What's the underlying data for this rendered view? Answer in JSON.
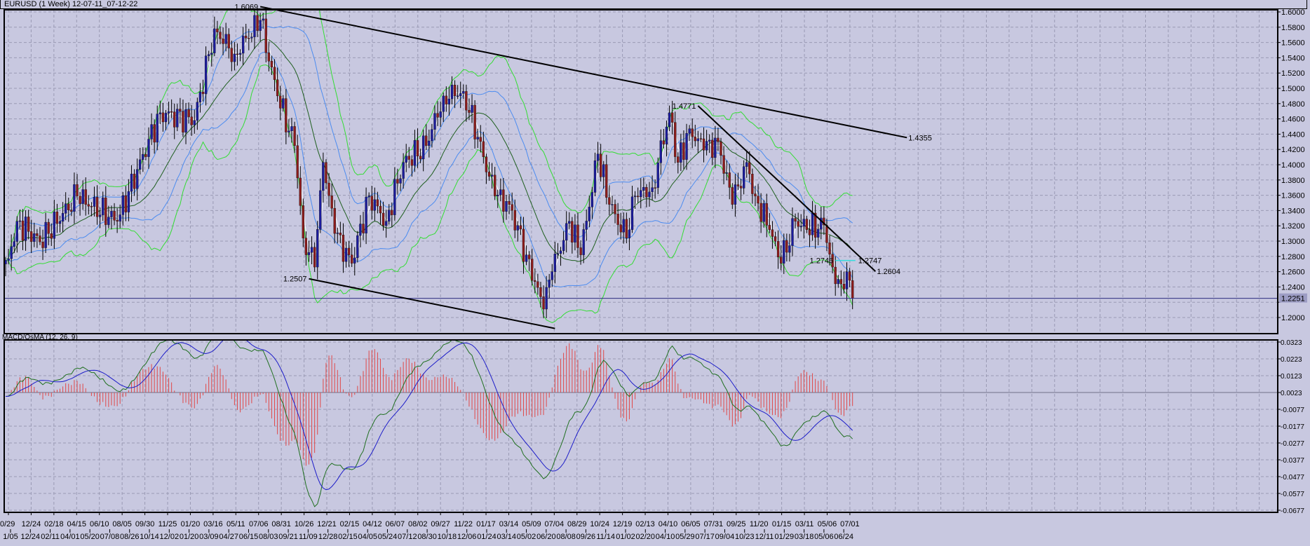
{
  "window": {
    "title": "EURUSD (1 Week) 12-07-11_07-12-22"
  },
  "indicator": {
    "label": "MACD/OsMA (12, 26, 9)"
  },
  "colors": {
    "background": "#c8c8e0",
    "bull": "#1c1c9c",
    "bear": "#8c1c1c",
    "bb_outer": "#33dd33",
    "bb_inner": "#4c8cf0",
    "ma": "#1f5f1f",
    "fast": "#ffffff",
    "macd_main": "#1f6f1f",
    "macd_signal": "#1c1cc8",
    "osma": "#e04848",
    "price_line": "#2c2c80",
    "cyan": "#33dddd"
  },
  "chart_data": [
    {
      "type": "candlestick",
      "title": "EURUSD (1 Week)",
      "bars": 297,
      "close_keypoints": [
        [
          0,
          1.275
        ],
        [
          1,
          1.277
        ],
        [
          4,
          1.326
        ],
        [
          12,
          1.299
        ],
        [
          25,
          1.359
        ],
        [
          39,
          1.326
        ],
        [
          54,
          1.468
        ],
        [
          66,
          1.458
        ],
        [
          73,
          1.578
        ],
        [
          80,
          1.545
        ],
        [
          89,
          1.589
        ],
        [
          95,
          1.49
        ],
        [
          101,
          1.425
        ],
        [
          104,
          1.304
        ],
        [
          108,
          1.266
        ],
        [
          111,
          1.403
        ],
        [
          115,
          1.31
        ],
        [
          121,
          1.271
        ],
        [
          127,
          1.359
        ],
        [
          133,
          1.326
        ],
        [
          139,
          1.403
        ],
        [
          147,
          1.425
        ],
        [
          153,
          1.49
        ],
        [
          160,
          1.496
        ],
        [
          165,
          1.436
        ],
        [
          171,
          1.359
        ],
        [
          176,
          1.348
        ],
        [
          182,
          1.282
        ],
        [
          188,
          1.211
        ],
        [
          191,
          1.26
        ],
        [
          197,
          1.326
        ],
        [
          201,
          1.282
        ],
        [
          207,
          1.414
        ],
        [
          211,
          1.348
        ],
        [
          217,
          1.304
        ],
        [
          220,
          1.359
        ],
        [
          226,
          1.37
        ],
        [
          232,
          1.468
        ],
        [
          235,
          1.403
        ],
        [
          239,
          1.447
        ],
        [
          244,
          1.419
        ],
        [
          249,
          1.43
        ],
        [
          254,
          1.348
        ],
        [
          259,
          1.403
        ],
        [
          262,
          1.359
        ],
        [
          267,
          1.315
        ],
        [
          271,
          1.271
        ],
        [
          276,
          1.326
        ],
        [
          280,
          1.315
        ],
        [
          286,
          1.321
        ],
        [
          289,
          1.266
        ],
        [
          292,
          1.244
        ],
        [
          294,
          1.26
        ],
        [
          296,
          1.2251
        ]
      ],
      "ylim": [
        1.18,
        1.612
      ],
      "yticks": [
        "1.6000",
        "1.5800",
        "1.5600",
        "1.5400",
        "1.5200",
        "1.5000",
        "1.4800",
        "1.4600",
        "1.4400",
        "1.4200",
        "1.4000",
        "1.3800",
        "1.3600",
        "1.3400",
        "1.3200",
        "1.3000",
        "1.2800",
        "1.2600",
        "1.2400",
        "1.2200",
        "1.2000"
      ],
      "current_price": "1.2251",
      "trendlines": [
        {
          "from": [
            89,
            1.6069
          ],
          "to": [
            315,
            1.4355
          ],
          "label_start": "1.6069",
          "label_end": "1.4355"
        },
        {
          "from": [
            106,
            1.2507
          ],
          "to": [
            192,
            1.1857
          ],
          "label_start": "1.2507"
        },
        {
          "from": [
            242,
            1.4771
          ],
          "to": [
            304,
            1.2604
          ],
          "label_start": "1.4771",
          "label_end": "1.2604"
        }
      ],
      "level_labels": [
        {
          "bar": 290,
          "price": 1.2746,
          "text": "1.2746"
        },
        {
          "bar": 297,
          "price": 1.2747,
          "text": "1.2747"
        }
      ],
      "overlays": [
        "Bollinger Bands outer (green)",
        "Bollinger Bands inner (blue)",
        "Moving Average (dark green)",
        "Fast MA (white)"
      ]
    },
    {
      "type": "line",
      "title": "MACD/OsMA (12, 26, 9)",
      "yticks": [
        "0.0323",
        "0.0223",
        "0.0123",
        "0.0023",
        "-0.0077",
        "-0.0177",
        "-0.0277",
        "-0.0377",
        "-0.0477",
        "-0.0577",
        "-0.0677"
      ],
      "ylim": [
        -0.0677,
        0.0323
      ],
      "params": [
        12,
        26,
        9
      ]
    }
  ],
  "xaxis": {
    "top_row": [
      "0/29",
      "12/24",
      "02/18",
      "04/15",
      "06/10",
      "08/05",
      "09/30",
      "11/25",
      "01/20",
      "03/16",
      "05/11",
      "07/06",
      "08/31",
      "10/26",
      "12/21",
      "02/15",
      "04/12",
      "06/07",
      "08/02",
      "09/27",
      "11/22",
      "01/17",
      "03/14",
      "05/09",
      "07/04",
      "08/29",
      "10/24",
      "12/19",
      "02/13",
      "04/10",
      "06/05",
      "07/31",
      "09/25",
      "11/20",
      "01/15",
      "03/11",
      "05/06",
      "07/01"
    ],
    "bottom_row": [
      "1/05",
      "12/24",
      "02/11",
      "04/01",
      "05/20",
      "07/08",
      "08/26",
      "10/14",
      "12/02",
      "01/20",
      "03/09",
      "04/27",
      "06/15",
      "08/03",
      "09/21",
      "11/09",
      "12/28",
      "02/15",
      "04/05",
      "05/24",
      "07/12",
      "08/30",
      "10/18",
      "12/06",
      "01/24",
      "03/14",
      "05/02",
      "06/20",
      "08/08",
      "09/26",
      "11/14",
      "01/02",
      "02/20",
      "04/10",
      "05/29",
      "07/17",
      "09/04",
      "10/23",
      "12/11",
      "01/29",
      "03/18",
      "05/06",
      "06/24"
    ]
  }
}
